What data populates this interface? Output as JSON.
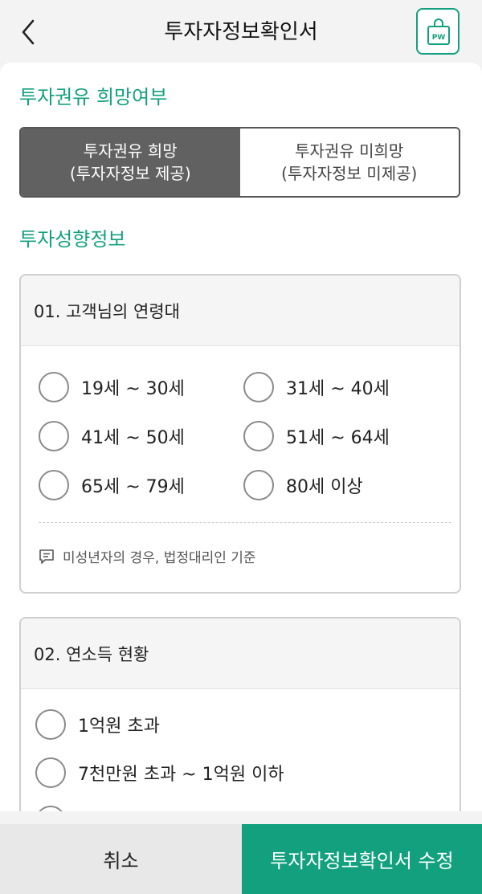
{
  "header": {
    "title": "투자자정보확인서",
    "pw_label": "PW"
  },
  "solicitation": {
    "section_title": "투자권유 희망여부",
    "options": [
      {
        "line1": "투자권유 희망",
        "line2": "(투자자정보 제공)",
        "selected": true
      },
      {
        "line1": "투자권유 미희망",
        "line2": "(투자자정보 미제공)",
        "selected": false
      }
    ]
  },
  "profile": {
    "section_title": "투자성향정보"
  },
  "q1": {
    "title": "01. 고객님의 연령대",
    "options": [
      "19세 ~ 30세",
      "31세 ~ 40세",
      "41세 ~ 50세",
      "51세 ~ 64세",
      "65세 ~ 79세",
      "80세 이상"
    ],
    "note": "미성년자의 경우, 법정대리인 기준"
  },
  "q2": {
    "title": "02. 연소득 현황",
    "options": [
      "1억원 초과",
      "7천만원 초과 ~ 1억원 이하"
    ]
  },
  "footer": {
    "cancel_label": "취소",
    "submit_label": "투자자정보확인서 수정"
  },
  "colors": {
    "accent": "#13a07f",
    "selected_segment": "#616161"
  }
}
